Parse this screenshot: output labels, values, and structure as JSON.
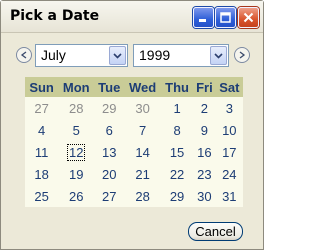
{
  "window": {
    "title": "Pick a Date",
    "controls": [
      "minimize-icon",
      "maximize-icon",
      "close-icon"
    ]
  },
  "nav": {
    "prev_icon": "chevron-left-icon",
    "next_icon": "chevron-right-icon",
    "month": "July",
    "year": "1999"
  },
  "calendar": {
    "weekdays": [
      "Sun",
      "Mon",
      "Tue",
      "Wed",
      "Thu",
      "Fri",
      "Sat"
    ],
    "weeks": [
      [
        "27",
        "28",
        "29",
        "30",
        "1",
        "2",
        "3"
      ],
      [
        "4",
        "5",
        "6",
        "7",
        "8",
        "9",
        "10"
      ],
      [
        "11",
        "12",
        "13",
        "14",
        "15",
        "16",
        "17"
      ],
      [
        "18",
        "19",
        "20",
        "21",
        "22",
        "23",
        "24"
      ],
      [
        "25",
        "26",
        "27",
        "28",
        "29",
        "30",
        "31"
      ]
    ],
    "selected_day": "12"
  },
  "footer": {
    "cancel_label": "Cancel"
  },
  "colors": {
    "header_bg": "#c9cc97",
    "grid_bg": "#fafaeb",
    "day_text": "#1d3d75",
    "muted_text": "#8d8d8d"
  }
}
